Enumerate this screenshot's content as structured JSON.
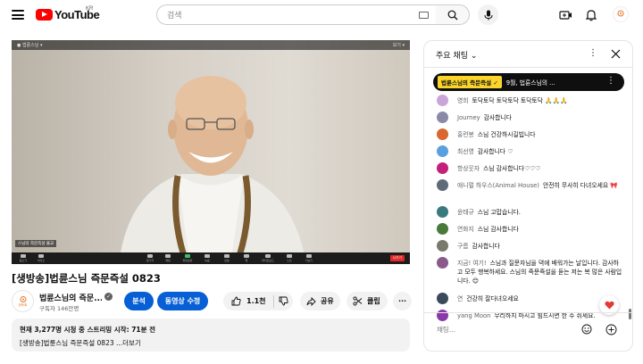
{
  "header": {
    "logo_text": "YouTube",
    "region": "KR",
    "search_placeholder": "검색",
    "icons": [
      "menu-icon",
      "keyboard-icon",
      "search-icon",
      "mic-icon",
      "create-icon",
      "bell-icon"
    ],
    "avatar_label": "정토회"
  },
  "video": {
    "top_left": "● 법륜스님 ▾",
    "top_right": "보기 ▾",
    "name_tag": "스님의 즉문즉설 불교",
    "controls": [
      "음소거",
      "비디오",
      "참가자",
      "채팅",
      "화면공유",
      "녹음",
      "반응",
      "앱",
      "화이트보드",
      "노트",
      "더보기"
    ],
    "end_label": "나가기"
  },
  "title": "[생방송]법륜스님 즉문즉설 0823",
  "channel": {
    "avatar_label": "정토회",
    "name": "법륜스님의 즉문...",
    "subscribers": "구독자 146만명"
  },
  "actions": {
    "analytics": "분석",
    "edit_video": "동영상 수정",
    "like_count": "1.1천",
    "share": "공유",
    "clip": "클립",
    "more": "···"
  },
  "description": {
    "line1": "현재 3,277명 시청 중  스트리밍 시작: 71분 전",
    "line2": "[생방송]법륜스님 즉문즉설 0823 ...더보기"
  },
  "chat": {
    "title": "주요 채팅",
    "pinned_badge": "법륜스님의 즉문즉설 ✓",
    "pinned_text": "9월, 법륜스님의 ...",
    "input_placeholder": "채팅...",
    "messages": [
      {
        "author": "영희",
        "text": "토닥토닥 토닥토닥 토닥토닥 🙏🙏🙏",
        "color": "#c9a6d8"
      },
      {
        "author": "Journey",
        "text": "감사합니다",
        "color": "#8a8aa8"
      },
      {
        "author": "홍련봉",
        "text": "스님 건강하시길빕니다",
        "color": "#d8662e"
      },
      {
        "author": "최선영",
        "text": "감사합니다 ♡",
        "color": "#5aa0e0"
      },
      {
        "author": "항상웃자",
        "text": "스님 감사합니다♡♡♡",
        "color": "#c4207a"
      },
      {
        "author": "애니멀 하우스(Animal House)",
        "text": "안전히 무사히 다녀오세요 🎀",
        "color": "#5d6a78"
      },
      {
        "author": "윤태규",
        "text": "스님 고맙습니다.",
        "color": "#3a7a7e"
      },
      {
        "author": "연화지",
        "text": "스님 감사합니다",
        "color": "#4a7a3a"
      },
      {
        "author": "구름",
        "text": "감사합니다",
        "color": "#7a7a6a"
      },
      {
        "author": "지금! 여기!",
        "text": "스님과 질문자님을 뎍에 배워가는 날입니다. 감사하고 모두 행복하세요. 스님의 즉문즉설을 듣는 저는 복 많은 사람입니다. 😊",
        "color": "#8a5a8a"
      },
      {
        "author": "연",
        "text": "건강히 잘다녀오세요",
        "color": "#3a4a5a"
      },
      {
        "author": "yang Moon",
        "text": "무리하지 마시고 힘드시면 한 주 쉬세요.",
        "color": "#8a3aa8"
      }
    ]
  }
}
